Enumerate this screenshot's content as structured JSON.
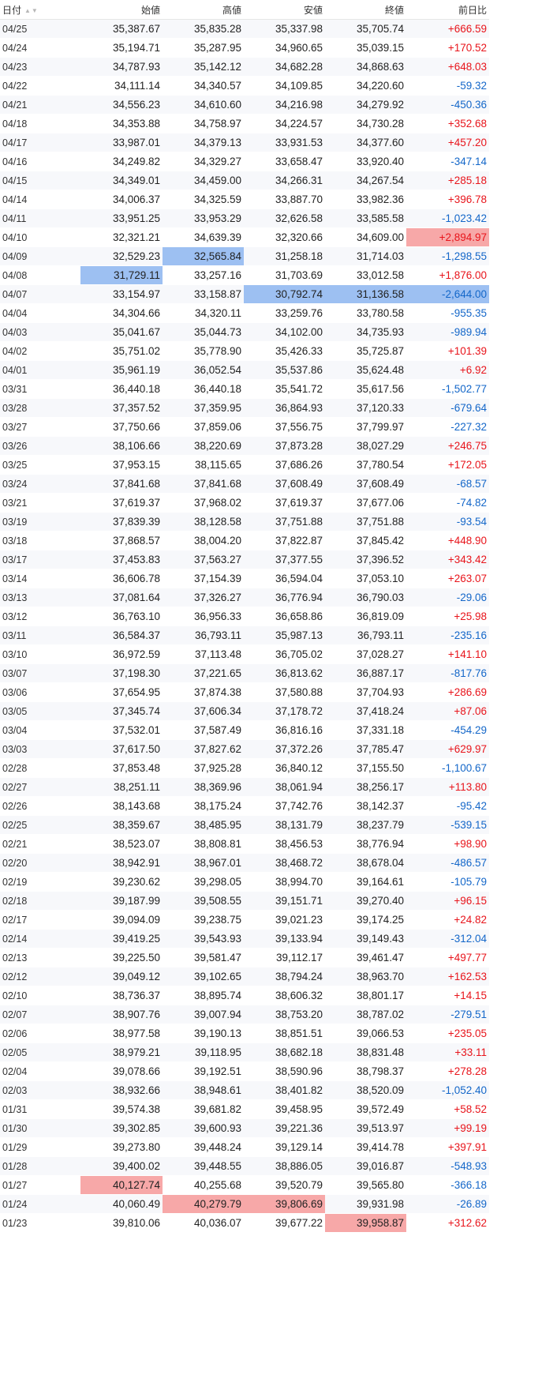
{
  "table": {
    "headers": [
      "日付",
      "始値",
      "高値",
      "安値",
      "終値",
      "前日比"
    ],
    "sort_icons": "▲▼",
    "colors": {
      "up": "#e8141b",
      "down": "#1467c9",
      "highlight_low": "#9dc0f2",
      "highlight_high": "#f7a8a8"
    },
    "rows": [
      [
        "04/25",
        "35,387.67",
        "35,835.28",
        "35,337.98",
        "35,705.74",
        "+666.59"
      ],
      [
        "04/24",
        "35,194.71",
        "35,287.95",
        "34,960.65",
        "35,039.15",
        "+170.52"
      ],
      [
        "04/23",
        "34,787.93",
        "35,142.12",
        "34,682.28",
        "34,868.63",
        "+648.03"
      ],
      [
        "04/22",
        "34,111.14",
        "34,340.57",
        "34,109.85",
        "34,220.60",
        "-59.32"
      ],
      [
        "04/21",
        "34,556.23",
        "34,610.60",
        "34,216.98",
        "34,279.92",
        "-450.36"
      ],
      [
        "04/18",
        "34,353.88",
        "34,758.97",
        "34,224.57",
        "34,730.28",
        "+352.68"
      ],
      [
        "04/17",
        "33,987.01",
        "34,379.13",
        "33,931.53",
        "34,377.60",
        "+457.20"
      ],
      [
        "04/16",
        "34,249.82",
        "34,329.27",
        "33,658.47",
        "33,920.40",
        "-347.14"
      ],
      [
        "04/15",
        "34,349.01",
        "34,459.00",
        "34,266.31",
        "34,267.54",
        "+285.18"
      ],
      [
        "04/14",
        "34,006.37",
        "34,325.59",
        "33,887.70",
        "33,982.36",
        "+396.78"
      ],
      [
        "04/11",
        "33,951.25",
        "33,953.29",
        "32,626.58",
        "33,585.58",
        "-1,023.42"
      ],
      [
        "04/10",
        "32,321.21",
        "34,639.39",
        "32,320.66",
        "34,609.00",
        "+2,894.97"
      ],
      [
        "04/09",
        "32,529.23",
        "32,565.84",
        "31,258.18",
        "31,714.03",
        "-1,298.55"
      ],
      [
        "04/08",
        "31,729.11",
        "33,257.16",
        "31,703.69",
        "33,012.58",
        "+1,876.00"
      ],
      [
        "04/07",
        "33,154.97",
        "33,158.87",
        "30,792.74",
        "31,136.58",
        "-2,644.00"
      ],
      [
        "04/04",
        "34,304.66",
        "34,320.11",
        "33,259.76",
        "33,780.58",
        "-955.35"
      ],
      [
        "04/03",
        "35,041.67",
        "35,044.73",
        "34,102.00",
        "34,735.93",
        "-989.94"
      ],
      [
        "04/02",
        "35,751.02",
        "35,778.90",
        "35,426.33",
        "35,725.87",
        "+101.39"
      ],
      [
        "04/01",
        "35,961.19",
        "36,052.54",
        "35,537.86",
        "35,624.48",
        "+6.92"
      ],
      [
        "03/31",
        "36,440.18",
        "36,440.18",
        "35,541.72",
        "35,617.56",
        "-1,502.77"
      ],
      [
        "03/28",
        "37,357.52",
        "37,359.95",
        "36,864.93",
        "37,120.33",
        "-679.64"
      ],
      [
        "03/27",
        "37,750.66",
        "37,859.06",
        "37,556.75",
        "37,799.97",
        "-227.32"
      ],
      [
        "03/26",
        "38,106.66",
        "38,220.69",
        "37,873.28",
        "38,027.29",
        "+246.75"
      ],
      [
        "03/25",
        "37,953.15",
        "38,115.65",
        "37,686.26",
        "37,780.54",
        "+172.05"
      ],
      [
        "03/24",
        "37,841.68",
        "37,841.68",
        "37,608.49",
        "37,608.49",
        "-68.57"
      ],
      [
        "03/21",
        "37,619.37",
        "37,968.02",
        "37,619.37",
        "37,677.06",
        "-74.82"
      ],
      [
        "03/19",
        "37,839.39",
        "38,128.58",
        "37,751.88",
        "37,751.88",
        "-93.54"
      ],
      [
        "03/18",
        "37,868.57",
        "38,004.20",
        "37,822.87",
        "37,845.42",
        "+448.90"
      ],
      [
        "03/17",
        "37,453.83",
        "37,563.27",
        "37,377.55",
        "37,396.52",
        "+343.42"
      ],
      [
        "03/14",
        "36,606.78",
        "37,154.39",
        "36,594.04",
        "37,053.10",
        "+263.07"
      ],
      [
        "03/13",
        "37,081.64",
        "37,326.27",
        "36,776.94",
        "36,790.03",
        "-29.06"
      ],
      [
        "03/12",
        "36,763.10",
        "36,956.33",
        "36,658.86",
        "36,819.09",
        "+25.98"
      ],
      [
        "03/11",
        "36,584.37",
        "36,793.11",
        "35,987.13",
        "36,793.11",
        "-235.16"
      ],
      [
        "03/10",
        "36,972.59",
        "37,113.48",
        "36,705.02",
        "37,028.27",
        "+141.10"
      ],
      [
        "03/07",
        "37,198.30",
        "37,221.65",
        "36,813.62",
        "36,887.17",
        "-817.76"
      ],
      [
        "03/06",
        "37,654.95",
        "37,874.38",
        "37,580.88",
        "37,704.93",
        "+286.69"
      ],
      [
        "03/05",
        "37,345.74",
        "37,606.34",
        "37,178.72",
        "37,418.24",
        "+87.06"
      ],
      [
        "03/04",
        "37,532.01",
        "37,587.49",
        "36,816.16",
        "37,331.18",
        "-454.29"
      ],
      [
        "03/03",
        "37,617.50",
        "37,827.62",
        "37,372.26",
        "37,785.47",
        "+629.97"
      ],
      [
        "02/28",
        "37,853.48",
        "37,925.28",
        "36,840.12",
        "37,155.50",
        "-1,100.67"
      ],
      [
        "02/27",
        "38,251.11",
        "38,369.96",
        "38,061.94",
        "38,256.17",
        "+113.80"
      ],
      [
        "02/26",
        "38,143.68",
        "38,175.24",
        "37,742.76",
        "38,142.37",
        "-95.42"
      ],
      [
        "02/25",
        "38,359.67",
        "38,485.95",
        "38,131.79",
        "38,237.79",
        "-539.15"
      ],
      [
        "02/21",
        "38,523.07",
        "38,808.81",
        "38,456.53",
        "38,776.94",
        "+98.90"
      ],
      [
        "02/20",
        "38,942.91",
        "38,967.01",
        "38,468.72",
        "38,678.04",
        "-486.57"
      ],
      [
        "02/19",
        "39,230.62",
        "39,298.05",
        "38,994.70",
        "39,164.61",
        "-105.79"
      ],
      [
        "02/18",
        "39,187.99",
        "39,508.55",
        "39,151.71",
        "39,270.40",
        "+96.15"
      ],
      [
        "02/17",
        "39,094.09",
        "39,238.75",
        "39,021.23",
        "39,174.25",
        "+24.82"
      ],
      [
        "02/14",
        "39,419.25",
        "39,543.93",
        "39,133.94",
        "39,149.43",
        "-312.04"
      ],
      [
        "02/13",
        "39,225.50",
        "39,581.47",
        "39,112.17",
        "39,461.47",
        "+497.77"
      ],
      [
        "02/12",
        "39,049.12",
        "39,102.65",
        "38,794.24",
        "38,963.70",
        "+162.53"
      ],
      [
        "02/10",
        "38,736.37",
        "38,895.74",
        "38,606.32",
        "38,801.17",
        "+14.15"
      ],
      [
        "02/07",
        "38,907.76",
        "39,007.94",
        "38,753.20",
        "38,787.02",
        "-279.51"
      ],
      [
        "02/06",
        "38,977.58",
        "39,190.13",
        "38,851.51",
        "39,066.53",
        "+235.05"
      ],
      [
        "02/05",
        "38,979.21",
        "39,118.95",
        "38,682.18",
        "38,831.48",
        "+33.11"
      ],
      [
        "02/04",
        "39,078.66",
        "39,192.51",
        "38,590.96",
        "38,798.37",
        "+278.28"
      ],
      [
        "02/03",
        "38,932.66",
        "38,948.61",
        "38,401.82",
        "38,520.09",
        "-1,052.40"
      ],
      [
        "01/31",
        "39,574.38",
        "39,681.82",
        "39,458.95",
        "39,572.49",
        "+58.52"
      ],
      [
        "01/30",
        "39,302.85",
        "39,600.93",
        "39,221.36",
        "39,513.97",
        "+99.19"
      ],
      [
        "01/29",
        "39,273.80",
        "39,448.24",
        "39,129.14",
        "39,414.78",
        "+397.91"
      ],
      [
        "01/28",
        "39,400.02",
        "39,448.55",
        "38,886.05",
        "39,016.87",
        "-548.93"
      ],
      [
        "01/27",
        "40,127.74",
        "40,255.68",
        "39,520.79",
        "39,565.80",
        "-366.18"
      ],
      [
        "01/24",
        "40,060.49",
        "40,279.79",
        "39,806.69",
        "39,931.98",
        "-26.89"
      ],
      [
        "01/23",
        "39,810.06",
        "40,036.07",
        "39,677.22",
        "39,958.87",
        "+312.62"
      ]
    ],
    "highlights": {
      "blue": [
        [
          12,
          2
        ],
        [
          13,
          1
        ],
        [
          14,
          3
        ],
        [
          14,
          4
        ],
        [
          14,
          5
        ]
      ],
      "red": [
        [
          11,
          5
        ],
        [
          61,
          1
        ],
        [
          62,
          2
        ],
        [
          62,
          3
        ],
        [
          63,
          4
        ]
      ]
    }
  }
}
